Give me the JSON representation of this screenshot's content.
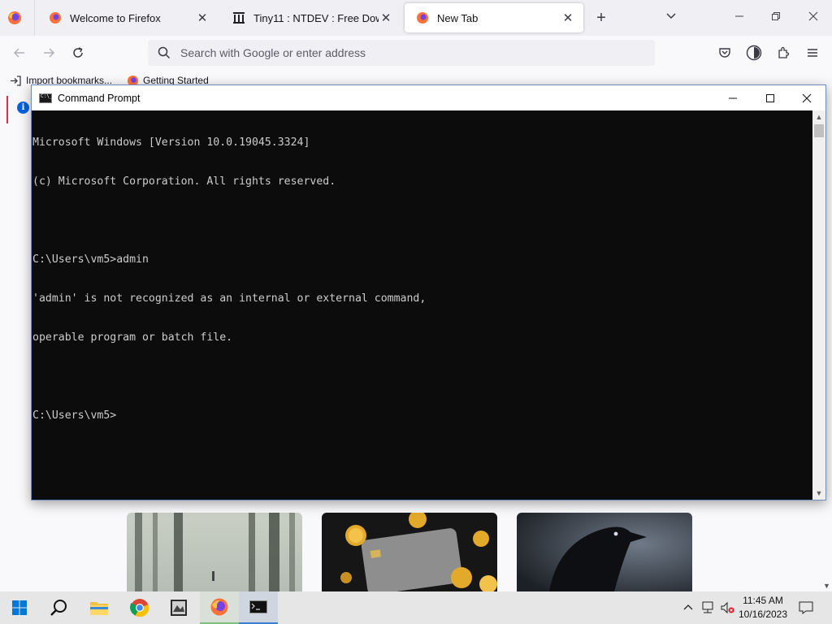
{
  "browser": {
    "tabs": [
      {
        "label": "Welcome to Firefox",
        "close": "✕"
      },
      {
        "label": "Tiny11 : NTDEV : Free Download, Borrow, and Streaming",
        "close": "✕"
      },
      {
        "label": "New Tab",
        "close": "✕"
      }
    ],
    "new_tab": "+",
    "list_all_tabs": "⌄",
    "window_controls": {
      "minimize": "—",
      "restore": "❐",
      "close": "✕"
    },
    "url_placeholder": "Search with Google or enter address",
    "bookmarks": [
      {
        "label": "Import bookmarks..."
      },
      {
        "label": "Getting Started"
      }
    ],
    "accent_color": "#e22850"
  },
  "cmd": {
    "title": "Command Prompt",
    "lines": [
      "Microsoft Windows [Version 10.0.19045.3324]",
      "(c) Microsoft Corporation. All rights reserved.",
      "",
      "C:\\Users\\vm5>admin",
      "'admin' is not recognized as an internal or external command,",
      "operable program or batch file.",
      "",
      "C:\\Users\\vm5>"
    ],
    "background_color": "#0c0c0c",
    "text_color": "#cccccc"
  },
  "taskbar": {
    "items": [
      "start-icon",
      "search-icon",
      "file-explorer-icon",
      "chrome-icon",
      "app-icon",
      "firefox-icon",
      "cmd-icon"
    ],
    "clock": {
      "time": "11:45 AM",
      "date": "10/16/2023"
    }
  }
}
